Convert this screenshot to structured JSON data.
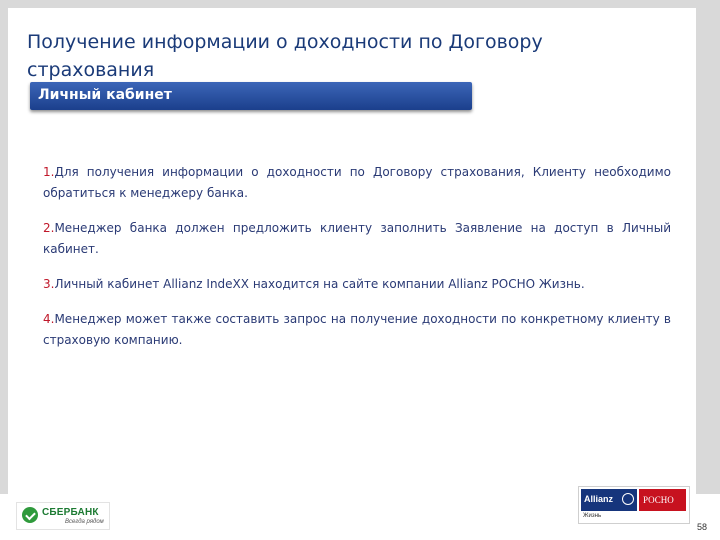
{
  "header": {
    "title": "Получение информации о доходности по Договору страхования"
  },
  "section": {
    "label": "Личный кабинет"
  },
  "steps": [
    {
      "num": "1.",
      "text": "Для получения информации о доходности по Договору страхования, Клиенту необходимо обратиться к менеджеру банка."
    },
    {
      "num": "2.",
      "text": "Менеджер банка должен предложить клиенту заполнить Заявление на доступ в Личный кабинет."
    },
    {
      "num": "3.",
      "text": "Личный кабинет Allianz IndeXX находится на сайте компании Allianz РОСНО Жизнь."
    },
    {
      "num": "4.",
      "text": "Менеджер может также составить запрос на получение доходности по конкретному клиенту в страховую компанию."
    }
  ],
  "footer": {
    "sberbank_name": "СБЕРБАНК",
    "sberbank_slogan": "Всегда рядом",
    "allianz_name": "Allianz",
    "rosno_name": "РОСНО",
    "zhizn": "Жизнь",
    "page_number": "58"
  },
  "colors": {
    "title": "#1a3a78",
    "bar": "#1b3f8c",
    "step_number": "#c0182a",
    "sberbank_green": "#2f9a3c",
    "allianz_blue": "#16357c",
    "rosno_red": "#c7121f"
  },
  "icons": [
    "sberbank-logo-icon",
    "allianz-eagle-icon"
  ]
}
